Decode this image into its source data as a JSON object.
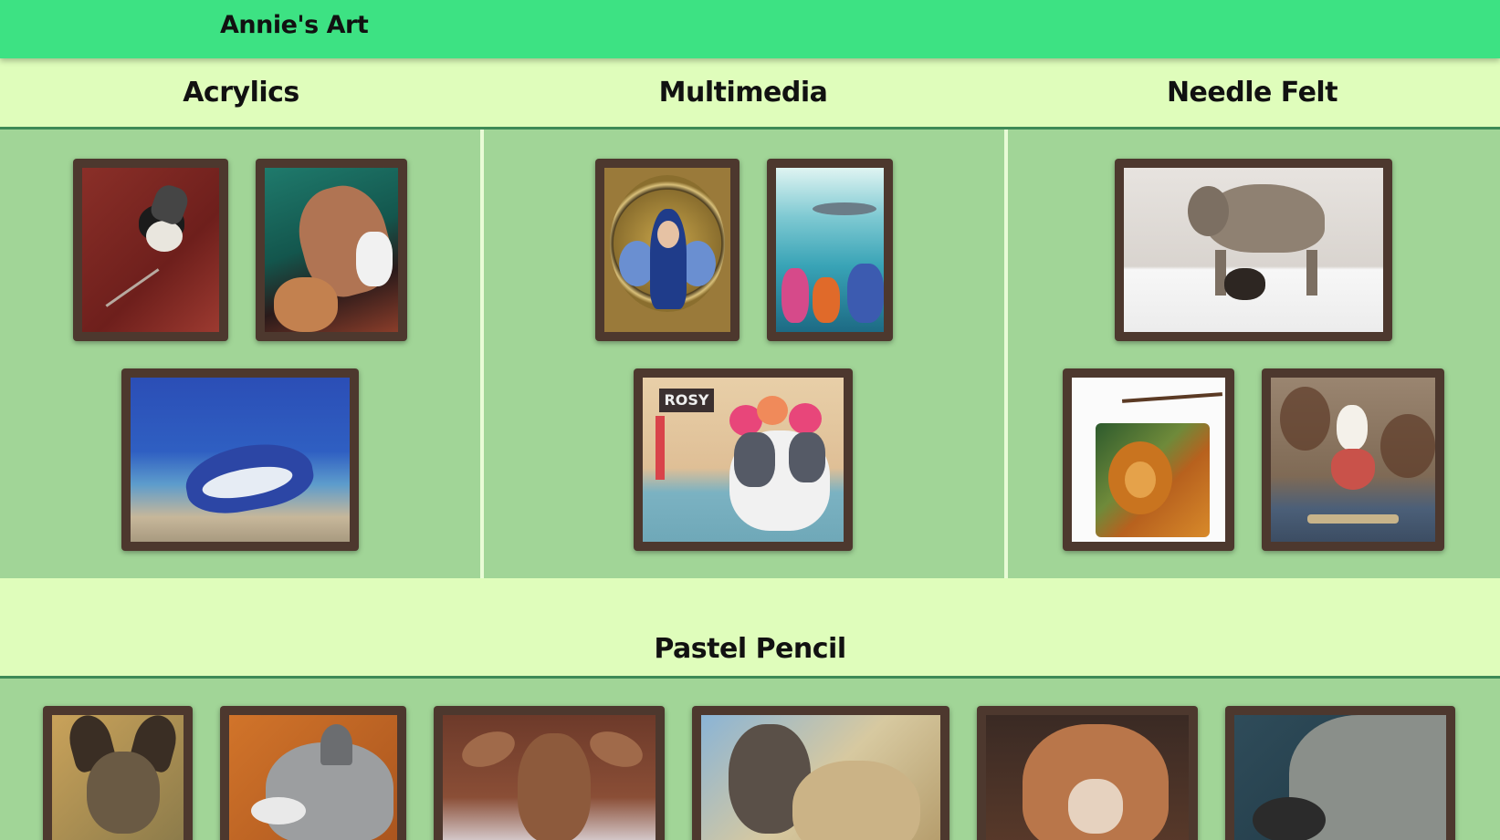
{
  "site": {
    "title": "Annie's Art"
  },
  "sections": {
    "acrylics": {
      "title": "Acrylics"
    },
    "multimedia": {
      "title": "Multimedia",
      "poster_text": "ROSY"
    },
    "needle_felt": {
      "title": "Needle Felt"
    },
    "pastel_pencil": {
      "title": "Pastel Pencil"
    }
  },
  "colors": {
    "header": "#3de283",
    "background": "#dffdbb",
    "panel": "#a1d597",
    "frame": "#4d382e",
    "rule": "#3d8a56"
  }
}
